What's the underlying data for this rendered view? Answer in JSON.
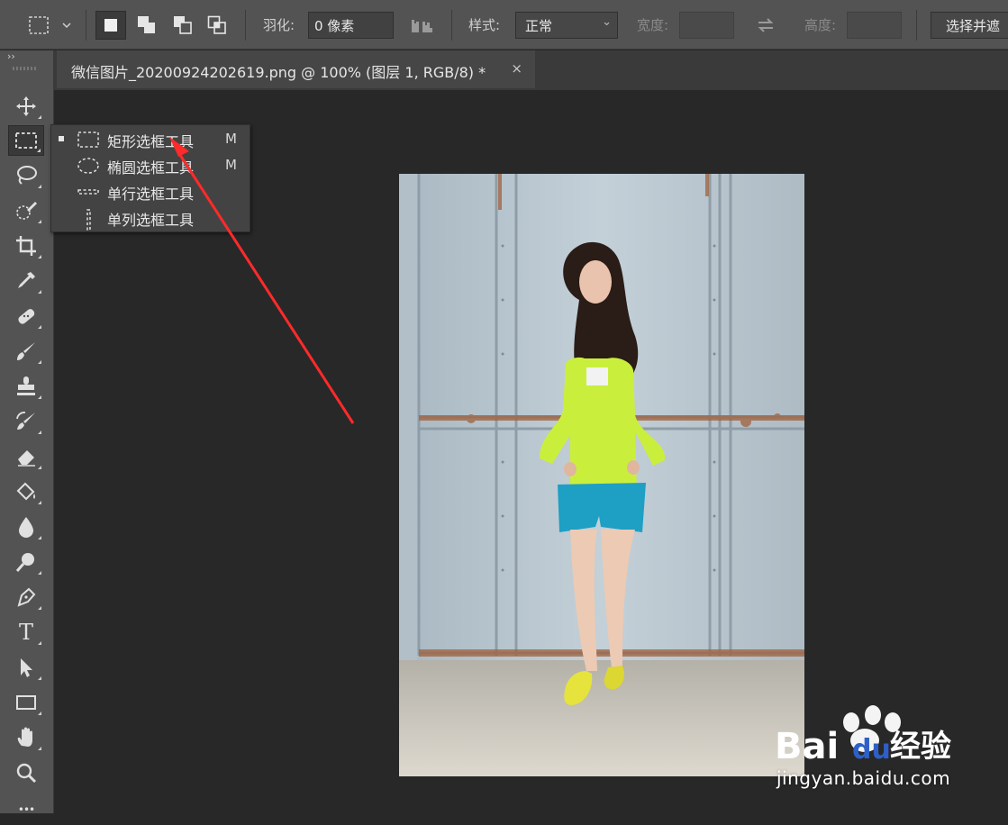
{
  "options_bar": {
    "feather_label": "羽化:",
    "feather_value": "0 像素",
    "style_label": "样式:",
    "style_value": "正常",
    "width_label": "宽度:",
    "height_label": "高度:",
    "select_mask_button": "选择并遮"
  },
  "document_tab": {
    "title": "微信图片_20200924202619.png @ 100% (图层 1, RGB/8) *",
    "close_glyph": "×"
  },
  "toolbar": {
    "collapse_glyph": "››",
    "tools": [
      {
        "name": "move-tool",
        "icon": "move-icon"
      },
      {
        "name": "rectangular-marquee-tool",
        "icon": "marquee-icon",
        "active": true
      },
      {
        "name": "lasso-tool",
        "icon": "lasso-icon"
      },
      {
        "name": "quick-selection-tool",
        "icon": "quick-select-icon"
      },
      {
        "name": "crop-tool",
        "icon": "crop-icon"
      },
      {
        "name": "eyedropper-tool",
        "icon": "eyedropper-icon"
      },
      {
        "name": "healing-brush-tool",
        "icon": "bandage-icon"
      },
      {
        "name": "brush-tool",
        "icon": "brush-icon"
      },
      {
        "name": "clone-stamp-tool",
        "icon": "stamp-icon"
      },
      {
        "name": "history-brush-tool",
        "icon": "history-brush-icon"
      },
      {
        "name": "eraser-tool",
        "icon": "eraser-icon"
      },
      {
        "name": "paint-bucket-tool",
        "icon": "bucket-icon"
      },
      {
        "name": "blur-tool",
        "icon": "drop-icon"
      },
      {
        "name": "dodge-tool",
        "icon": "dodge-icon"
      },
      {
        "name": "pen-tool",
        "icon": "pen-icon"
      },
      {
        "name": "type-tool",
        "icon": "type-icon",
        "glyph": "T"
      },
      {
        "name": "path-selection-tool",
        "icon": "arrow-icon"
      },
      {
        "name": "rectangle-tool",
        "icon": "rectangle-icon"
      },
      {
        "name": "hand-tool",
        "icon": "hand-icon"
      },
      {
        "name": "zoom-tool",
        "icon": "zoom-icon"
      },
      {
        "name": "more-tools",
        "icon": "ellipsis-icon",
        "glyph": "•••"
      }
    ]
  },
  "marquee_flyout": {
    "items": [
      {
        "label": "矩形选框工具",
        "shortcut": "M",
        "selected": true
      },
      {
        "label": "椭圆选框工具",
        "shortcut": "M"
      },
      {
        "label": "单行选框工具",
        "shortcut": ""
      },
      {
        "label": "单列选框工具",
        "shortcut": ""
      }
    ]
  },
  "annotation": {
    "arrow_color": "#ff2a2a"
  },
  "watermark": {
    "brand_left": "Bai",
    "brand_mid": "du",
    "brand_right": "经验",
    "url": "jingyan.baidu.com"
  },
  "colors": {
    "ui_panel": "#535353",
    "workspace": "#282828",
    "jacket": "#c9ef3c",
    "shorts": "#1e9fc4",
    "door": "#b9c7d0"
  }
}
